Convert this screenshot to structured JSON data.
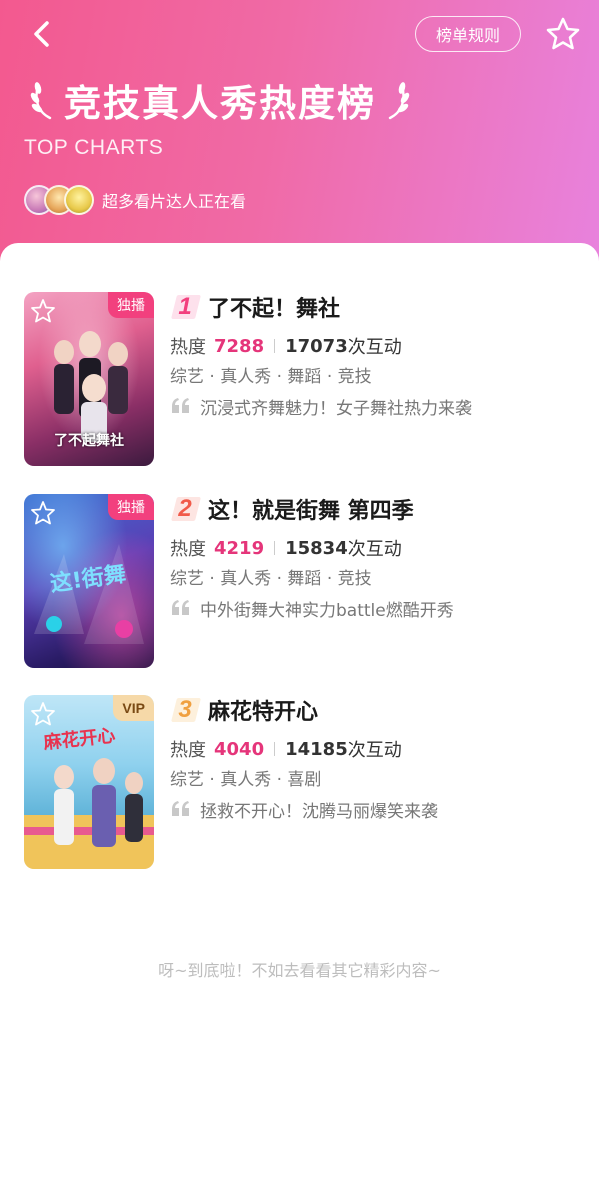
{
  "header": {
    "title": "竞技真人秀热度榜",
    "subtitle": "TOP CHARTS",
    "rules_label": "榜单规则",
    "watchers_text": "超多看片达人正在看"
  },
  "list": [
    {
      "rank": "1",
      "badge": "独播",
      "title": "了不起！舞社",
      "heat_label": "热度",
      "heat": "7288",
      "interactions": "17073",
      "interactions_suffix": "次互动",
      "tags": "综艺 · 真人秀 · 舞蹈 · 竞技",
      "desc": "沉浸式齐舞魅力！女子舞社热力来袭",
      "poster_caption": "了不起舞社"
    },
    {
      "rank": "2",
      "badge": "独播",
      "title": "这！就是街舞 第四季",
      "heat_label": "热度",
      "heat": "4219",
      "interactions": "15834",
      "interactions_suffix": "次互动",
      "tags": "综艺 · 真人秀 · 舞蹈 · 竞技",
      "desc": "中外街舞大神实力battle燃酷开秀",
      "poster_caption": "这!就是街舞"
    },
    {
      "rank": "3",
      "badge": "VIP",
      "title": "麻花特开心",
      "heat_label": "热度",
      "heat": "4040",
      "interactions": "14185",
      "interactions_suffix": "次互动",
      "tags": "综艺 · 真人秀 · 喜剧",
      "desc": "拯救不开心！沈腾马丽爆笑来袭",
      "poster_caption": "麻花特开心"
    }
  ],
  "footer": {
    "end_text": "呀~到底啦！不如去看看其它精彩内容~"
  },
  "colors": {
    "header_gradient_start": "#f3598f",
    "header_gradient_end": "#e882dd",
    "accent_pink": "#e5357a",
    "badge_pink": "#f2407e",
    "badge_vip": "#f6d9a8"
  },
  "icons": {
    "back": "chevron-left-icon",
    "favorite": "star-outline-icon",
    "laurel": "laurel-icon",
    "quote": "quote-icon"
  }
}
